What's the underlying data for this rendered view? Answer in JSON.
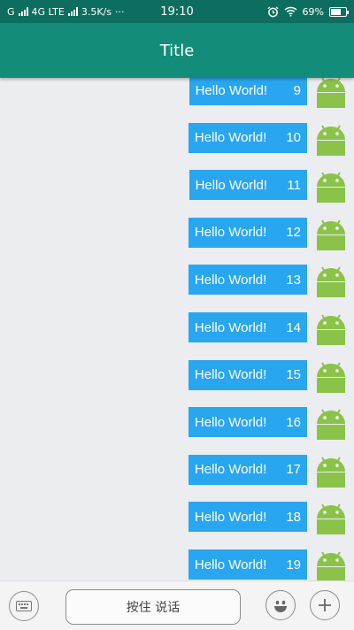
{
  "status_bar": {
    "carrier_left": "G",
    "network_type": "4G LTE",
    "speed": "3.5K/s",
    "more": "···",
    "time": "19:10",
    "battery_percent": "69%",
    "battery_level": 0.69,
    "icons": [
      "signal-icon",
      "alarm-icon",
      "wifi-icon",
      "battery-icon"
    ]
  },
  "app_bar": {
    "title": "Title"
  },
  "messages": [
    {
      "text": "Hello World!",
      "num": "9"
    },
    {
      "text": "Hello World!",
      "num": "10"
    },
    {
      "text": "Hello World!",
      "num": "11"
    },
    {
      "text": "Hello World!",
      "num": "12"
    },
    {
      "text": "Hello World!",
      "num": "13"
    },
    {
      "text": "Hello World!",
      "num": "14"
    },
    {
      "text": "Hello World!",
      "num": "15"
    },
    {
      "text": "Hello World!",
      "num": "16"
    },
    {
      "text": "Hello World!",
      "num": "17"
    },
    {
      "text": "Hello World!",
      "num": "18"
    },
    {
      "text": "Hello World!",
      "num": "19"
    }
  ],
  "input_bar": {
    "voice_label": "按住 说话",
    "icons": [
      "keyboard-icon",
      "emoji-icon",
      "plus-icon"
    ]
  },
  "colors": {
    "status_bar": "#0d6e5f",
    "app_bar": "#138c7a",
    "bubble": "#29a6f0",
    "android": "#8bc34a",
    "background": "#ecedf1"
  }
}
